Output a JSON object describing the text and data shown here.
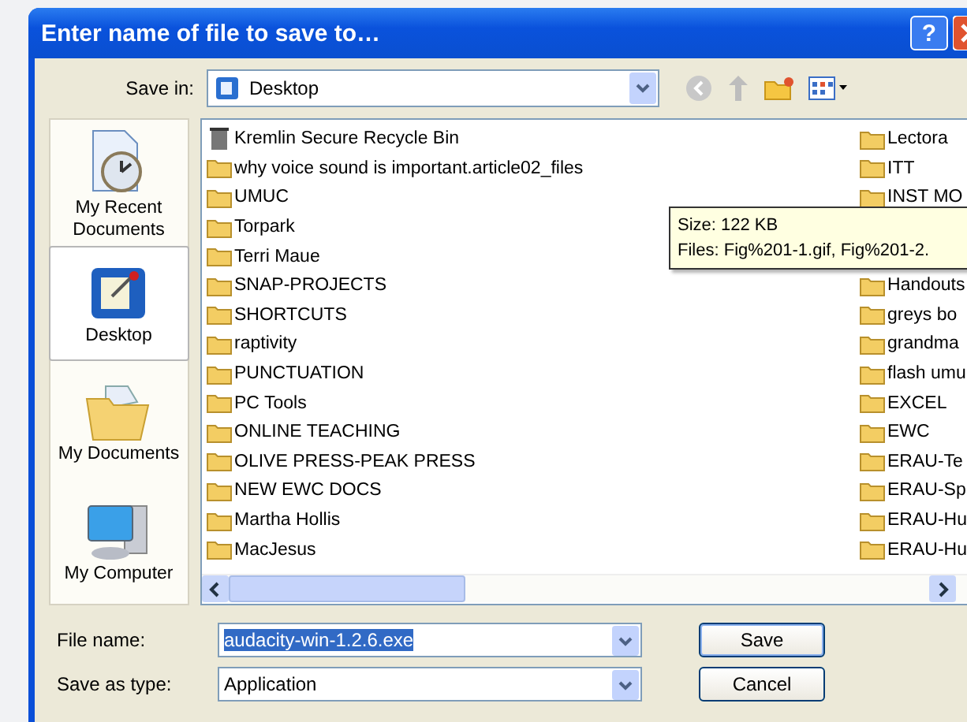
{
  "window": {
    "title": "Enter name of file to save to…",
    "help_button": "?"
  },
  "save_in": {
    "label": "Save in:",
    "value": "Desktop"
  },
  "places": [
    {
      "label": "My Recent Documents",
      "kind": "recent",
      "selected": false
    },
    {
      "label": "Desktop",
      "kind": "desktop",
      "selected": true
    },
    {
      "label": "My Documents",
      "kind": "documents",
      "selected": false
    },
    {
      "label": "My Computer",
      "kind": "computer",
      "selected": false
    }
  ],
  "files_left": [
    {
      "name": "Kremlin Secure Recycle Bin",
      "kind": "bin"
    },
    {
      "name": "why voice sound is important.article02_files",
      "kind": "folder"
    },
    {
      "name": "UMUC",
      "kind": "folder"
    },
    {
      "name": "Torpark",
      "kind": "folder"
    },
    {
      "name": "Terri Maue",
      "kind": "folder"
    },
    {
      "name": "SNAP-PROJECTS",
      "kind": "folder"
    },
    {
      "name": "SHORTCUTS",
      "kind": "folder"
    },
    {
      "name": "raptivity",
      "kind": "folder"
    },
    {
      "name": "PUNCTUATION",
      "kind": "folder"
    },
    {
      "name": "PC Tools",
      "kind": "folder"
    },
    {
      "name": "ONLINE TEACHING",
      "kind": "folder"
    },
    {
      "name": "OLIVE PRESS-PEAK PRESS",
      "kind": "folder"
    },
    {
      "name": "NEW EWC DOCS",
      "kind": "folder"
    },
    {
      "name": "Martha Hollis",
      "kind": "folder"
    },
    {
      "name": "MacJesus",
      "kind": "folder"
    }
  ],
  "files_right_top": [
    {
      "name": "Lectora",
      "kind": "folder"
    },
    {
      "name": "ITT",
      "kind": "folder"
    },
    {
      "name": "INST MO",
      "kind": "folder"
    }
  ],
  "files_right_bottom": [
    {
      "name": "Handouts",
      "kind": "folder"
    },
    {
      "name": "greys bo",
      "kind": "folder"
    },
    {
      "name": "grandma",
      "kind": "folder"
    },
    {
      "name": "flash umu",
      "kind": "folder"
    },
    {
      "name": "EXCEL",
      "kind": "folder"
    },
    {
      "name": "EWC",
      "kind": "folder"
    },
    {
      "name": "ERAU-Te",
      "kind": "folder"
    },
    {
      "name": "ERAU-Sp",
      "kind": "folder"
    },
    {
      "name": "ERAU-Hu",
      "kind": "folder"
    },
    {
      "name": "ERAU-Hu",
      "kind": "folder"
    }
  ],
  "tooltip": [
    "Size: 122 KB",
    "Files: Fig%201-1.gif, Fig%201-2."
  ],
  "file_name": {
    "label": "File name:",
    "value": "audacity-win-1.2.6.exe"
  },
  "save_as_type": {
    "label": "Save as type:",
    "value": "Application"
  },
  "buttons": [
    "Save",
    "Cancel"
  ]
}
